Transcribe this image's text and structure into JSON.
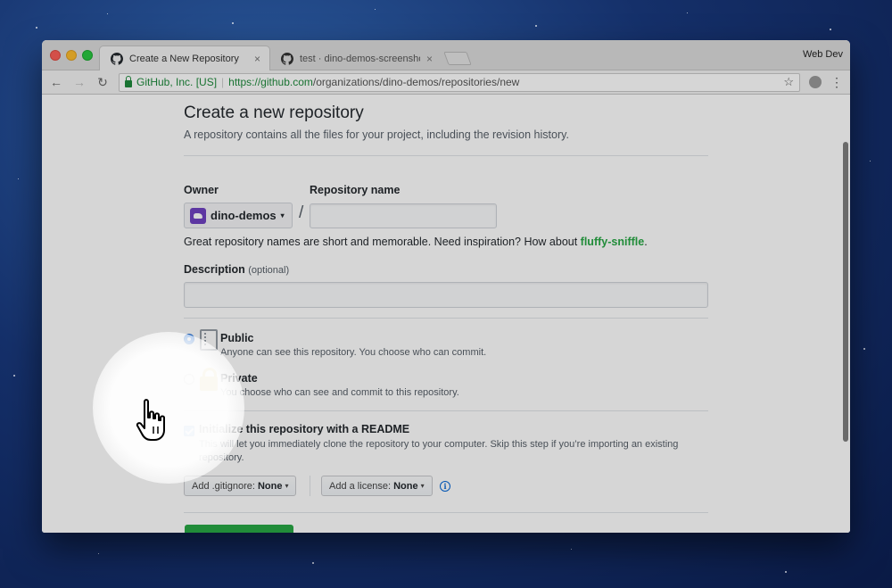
{
  "window": {
    "profile": "Web Dev",
    "tabs": [
      {
        "title": "Create a New Repository",
        "close": "×"
      },
      {
        "title": "test · dino-demos-screenshot",
        "close": "×"
      }
    ]
  },
  "toolbar": {
    "back": "←",
    "forward": "→",
    "reload": "↻",
    "ev_label": "GitHub, Inc. [US]",
    "separator": "|",
    "url_scheme_host": "https://github.com",
    "url_path": "/organizations/dino-demos/repositories/new",
    "bookmark": "☆",
    "menu": "⋮"
  },
  "form": {
    "title": "Create a new repository",
    "subtitle": "A repository contains all the files for your project, including the revision history.",
    "owner_label": "Owner",
    "owner_value": "dino-demos",
    "owner_caret": "▾",
    "slash": "/",
    "repo_name_label": "Repository name",
    "repo_name_value": "",
    "hint_text": "Great repository names are short and memorable. Need inspiration? How about ",
    "hint_suggestion": "fluffy-sniffle",
    "hint_end": ".",
    "description_label": "Description",
    "description_optional": "(optional)",
    "description_value": "",
    "visibility": {
      "public_title": "Public",
      "public_desc": "Anyone can see this repository. You choose who can commit.",
      "private_title": "Private",
      "private_desc": "You choose who can see and commit to this repository.",
      "selected": "public"
    },
    "readme": {
      "checked": true,
      "title": "Initialize this repository with a README",
      "desc": "This will let you immediately clone the repository to your computer. Skip this step if you’re importing an existing repository."
    },
    "gitignore_label": "Add .gitignore:",
    "gitignore_value": "None",
    "license_label": "Add a license:",
    "license_value": "None",
    "caret": "▾",
    "info": "i"
  },
  "colors": {
    "accent_blue": "#3c8cf5",
    "github_green": "#28a745",
    "ev_green": "#1e8a3c",
    "lock_gold": "#dbab09"
  }
}
